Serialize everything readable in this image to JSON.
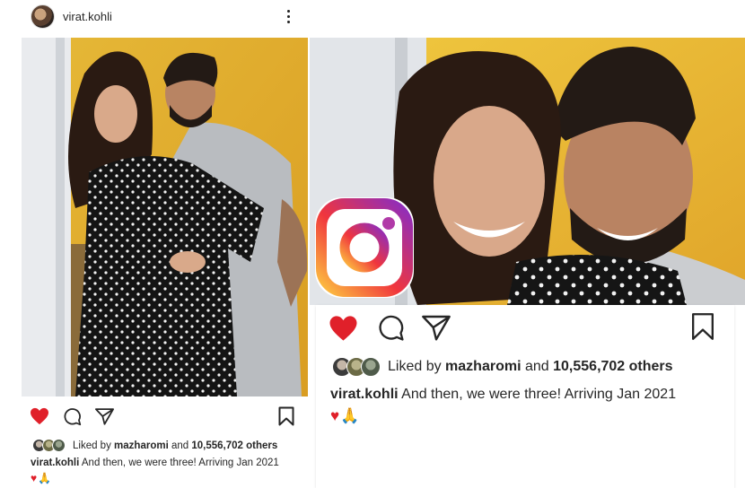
{
  "post": {
    "username": "virat.kohli",
    "liked_by_prefix": "Liked by",
    "liked_by_user": "mazharomi",
    "liked_by_and": "and",
    "likes_count": "10,556,702 others",
    "caption_text": "And then, we were three! Arriving Jan 2021",
    "emoji_heart": "♥",
    "emoji_pray": "🙏"
  },
  "icons": [
    "heart-icon",
    "comment-icon",
    "share-icon",
    "bookmark-icon",
    "more-options-icon",
    "instagram-logo"
  ],
  "colors": {
    "heart_red": "#e0202a",
    "ig_gradient_start": "#fdc540",
    "ig_gradient_mid": "#f0353d",
    "ig_gradient_end": "#8a2dc2"
  }
}
